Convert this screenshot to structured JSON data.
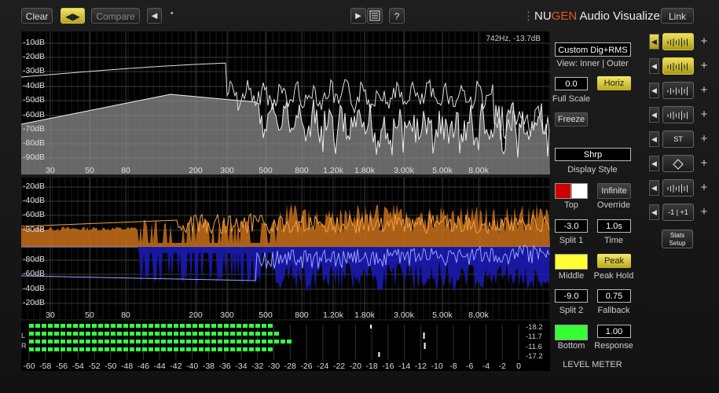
{
  "toolbar": {
    "clear_label": "Clear",
    "swap_icon": "double-arrow-icon",
    "compare_label": "Compare",
    "back_arrow": "◀",
    "dot": "•",
    "play_icon": "▶",
    "list_icon": "list-icon",
    "help_label": "?",
    "brand_prefix": "⋮",
    "brand_nu": "NU",
    "brand_gen": "GEN",
    "brand_rest": " Audio Visualizer",
    "link_label": "Link"
  },
  "spectrum": {
    "readout": "742Hz, -13.7dB",
    "y_labels": [
      "-10dB",
      "-20dB",
      "-30dB",
      "-40dB",
      "-50dB",
      "-60dB",
      "-70dB",
      "-80dB",
      "-90dB"
    ],
    "x_labels": [
      "30",
      "50",
      "80",
      "200",
      "300",
      "500",
      "800",
      "1.20k",
      "1.80k",
      "3.00k",
      "5.00k",
      "8.00k"
    ]
  },
  "split": {
    "y_labels_top": [
      "-20dB",
      "-40dB",
      "-60dB",
      "-80dB"
    ],
    "y_labels_bottom": [
      "-80dB",
      "-60dB",
      "-40dB",
      "-20dB"
    ],
    "x_labels": [
      "30",
      "50",
      "80",
      "200",
      "300",
      "500",
      "800",
      "1.20k",
      "1.80k",
      "3.00k",
      "5.00k",
      "8.00k"
    ]
  },
  "level_meter": {
    "channels": [
      "L",
      "R"
    ],
    "scale": [
      "-60",
      "-58",
      "-56",
      "-54",
      "-52",
      "-50",
      "-48",
      "-46",
      "-44",
      "-42",
      "-40",
      "-38",
      "-36",
      "-34",
      "-32",
      "-30",
      "-28",
      "-26",
      "-24",
      "-22",
      "-20",
      "-18",
      "-16",
      "-14",
      "-12",
      "-10",
      "-8",
      "-6",
      "-4",
      "-2",
      "0"
    ],
    "readouts": [
      "-18.2",
      "-11.7",
      "-11.6",
      "-17.2"
    ],
    "title": "LEVEL METER",
    "l_level_db": -29.5,
    "r_level_db": -27.8,
    "l_rms_db": -30.5,
    "r_rms_db": -30.0
  },
  "controls": {
    "preset": "Custom Dig+RMS",
    "view_label": "View: Inner | Outer",
    "full_scale_value": "0.0",
    "full_scale_label": "Full Scale",
    "horiz_label": "Horiz",
    "freeze_label": "Freeze",
    "display_style_value": "Shrp",
    "display_style_label": "Display Style",
    "top_label": "Top",
    "infinite_label": "Infinite",
    "override_label": "Override",
    "split1_value": "-3.0",
    "split1_label": "Split 1",
    "time_value": "1.0s",
    "time_label": "Time",
    "middle_label": "Middle",
    "peak_label": "Peak",
    "peak_hold_label": "Peak Hold",
    "split2_value": "-9.0",
    "split2_label": "Split 2",
    "fallback_value": "0.75",
    "fallback_label": "Fallback",
    "bottom_label": "Bottom",
    "response_value": "1.00",
    "response_label": "Response",
    "colors": {
      "top_red": "#cc0000",
      "top_white": "#ffffff",
      "middle": "#ffff33",
      "bottom": "#33ff33",
      "accent": "#e6d64a"
    }
  },
  "side_modes": {
    "items": [
      {
        "icon": "spectrum-lines-icon"
      },
      {
        "icon": "bar-meter-icon"
      },
      {
        "icon": "waveform-icon"
      },
      {
        "icon": "spectrogram-icon"
      },
      {
        "icon": "stereo-icon",
        "text": "ST"
      },
      {
        "icon": "diamond-icon"
      },
      {
        "icon": "phase-icon"
      },
      {
        "icon": "correlation-icon",
        "text": "-1 | +1"
      }
    ],
    "stats_label_1": "Stats",
    "stats_label_2": "Setup"
  }
}
